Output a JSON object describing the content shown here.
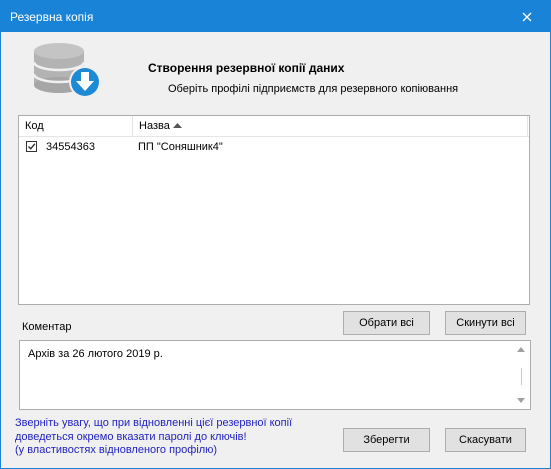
{
  "window": {
    "title": "Резервна копія"
  },
  "header": {
    "icon": "database-download-icon",
    "title": "Створення резервної копії даних",
    "subtitle": "Оберіть профілі підприємств для резервного копіювання"
  },
  "table": {
    "columns": [
      "Код",
      "Назва"
    ],
    "sort": {
      "column": "Назва",
      "direction": "ascending"
    },
    "rows": [
      {
        "checked": true,
        "code": "34554363",
        "name": "ПП \"Соняшник4\""
      }
    ]
  },
  "comment": {
    "label": "Коментар",
    "value": "Архів за 26 лютого 2019 р."
  },
  "buttons": {
    "select_all": "Обрати всі",
    "reset_all": "Скинути всі",
    "save": "Зберегти",
    "cancel": "Скасувати"
  },
  "warning": {
    "lines": [
      "Зверніть увагу, що при відновленні цієї резервної копії",
      "доведеться окремо вказати паролі до ключів!",
      "(у властивостях відновленого профілю)"
    ]
  },
  "colors": {
    "titlebar": "#1883d7",
    "warning_text": "#1f1fbf",
    "icon_blue": "#1e8ad6"
  }
}
